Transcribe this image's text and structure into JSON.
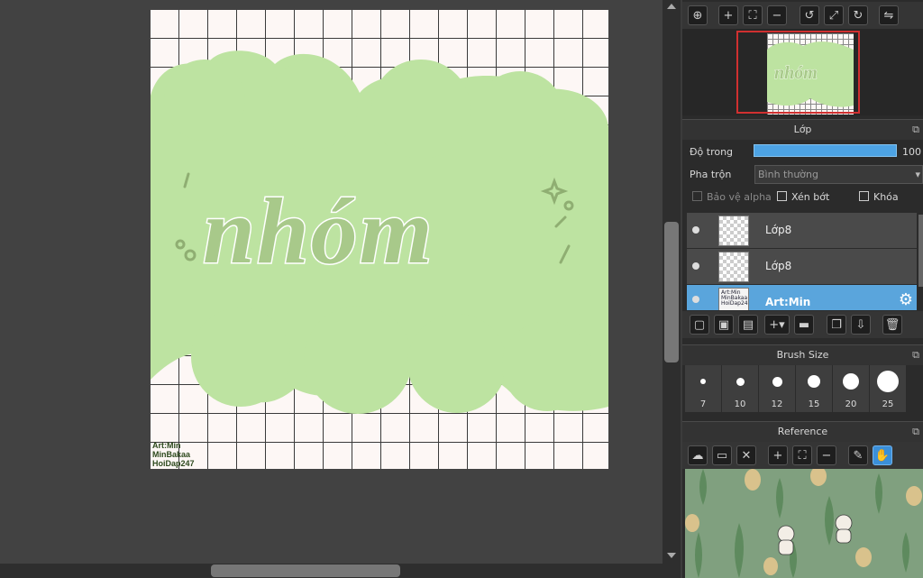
{
  "canvas": {
    "lettering": "nhóm",
    "credit_lines": [
      "Art:Min",
      "MinBakaa",
      "HoiDap247"
    ]
  },
  "navigator": {
    "tools": [
      "zoom-in-magnifier-icon",
      "zoom-in-icon",
      "fit-icon",
      "zoom-out-icon",
      "rotate-left-icon",
      "reset-view-icon",
      "rotate-right-icon",
      "flip-icon"
    ]
  },
  "layer_panel": {
    "title": "Lớp",
    "opacity_label": "Độ trong",
    "opacity_value": "100",
    "opacity_fraction": 1.0,
    "blend_label": "Pha trộn",
    "blend_value": "Bình thường",
    "protect_alpha": "Bảo vệ alpha",
    "clipping": "Xén bớt",
    "lock": "Khóa",
    "layers": [
      {
        "name": "Lớp8",
        "selected": false
      },
      {
        "name": "Lớp8",
        "selected": false
      },
      {
        "name": "Art:Min",
        "selected": true
      }
    ],
    "selected_thumb_text": "Art:Min MinBakaa HoiDap247"
  },
  "brush_panel": {
    "title": "Brush Size",
    "sizes": [
      "7",
      "10",
      "12",
      "15",
      "20",
      "25"
    ]
  },
  "reference_panel": {
    "title": "Reference"
  },
  "colors": {
    "accent": "#4da3e4",
    "cloud_green": "#bde3a1",
    "letter_green": "#a8c98a"
  }
}
